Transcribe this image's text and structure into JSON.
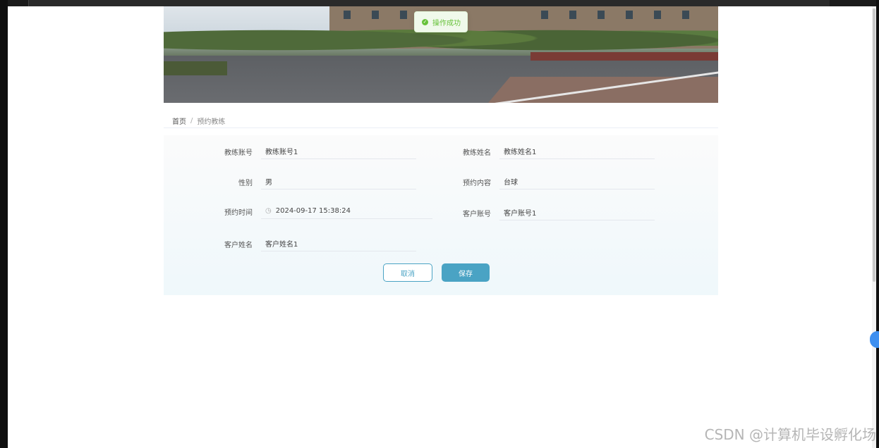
{
  "toast": {
    "message": "操作成功",
    "icon": "check-circle-icon",
    "color": "#67c23a"
  },
  "breadcrumb": {
    "home": "首页",
    "separator": "/",
    "current": "预约教练"
  },
  "form": {
    "coach_account": {
      "label": "教练账号",
      "value": "教练账号1"
    },
    "coach_name": {
      "label": "教练姓名",
      "value": "教练姓名1"
    },
    "gender": {
      "label": "性别",
      "value": "男"
    },
    "content": {
      "label": "预约内容",
      "value": "台球"
    },
    "time": {
      "label": "预约时间",
      "value": "2024-09-17 15:38:24",
      "icon": "clock-icon"
    },
    "customer_account": {
      "label": "客户账号",
      "value": "客户账号1"
    },
    "customer_name": {
      "label": "客户姓名",
      "value": "客户姓名1"
    }
  },
  "buttons": {
    "cancel": "取消",
    "save": "保存"
  },
  "colors": {
    "accent": "#4aa3c4",
    "success": "#67c23a"
  },
  "watermark": "CSDN @计算机毕设孵化场"
}
